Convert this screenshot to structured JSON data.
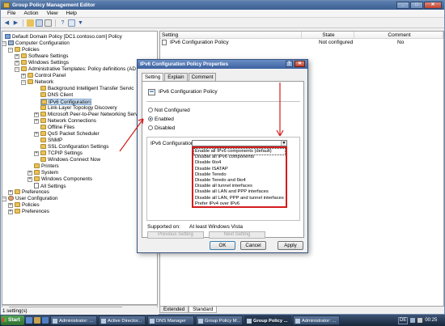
{
  "window": {
    "title": "Group Policy Management Editor",
    "menu": [
      "File",
      "Action",
      "View",
      "Help"
    ]
  },
  "tree": {
    "nodes": [
      {
        "label": "Default Domain Policy [DC1.contoso.com] Policy",
        "icon": "policy-icon"
      },
      {
        "label": "Computer Configuration",
        "icon": "computer-icon"
      },
      {
        "label": "Policies",
        "icon": "folder-icon"
      },
      {
        "label": "Software Settings",
        "icon": "folder-icon"
      },
      {
        "label": "Windows Settings",
        "icon": "folder-icon"
      },
      {
        "label": "Administrative Templates: Policy definitions (AD",
        "icon": "folder-icon"
      },
      {
        "label": "Control Panel",
        "icon": "folder-icon"
      },
      {
        "label": "Network",
        "icon": "folder-icon"
      },
      {
        "label": "Background Intelligent Transfer Servic",
        "icon": "folder-icon"
      },
      {
        "label": "DNS Client",
        "icon": "folder-icon"
      },
      {
        "label": "IPv6 Configuration",
        "icon": "folder-icon"
      },
      {
        "label": "Link-Layer Topology Discovery",
        "icon": "folder-icon"
      },
      {
        "label": "Microsoft Peer-to-Peer Networking Serv",
        "icon": "folder-icon"
      },
      {
        "label": "Network Connections",
        "icon": "folder-icon"
      },
      {
        "label": "Offline Files",
        "icon": "folder-icon"
      },
      {
        "label": "QoS Packet Scheduler",
        "icon": "folder-icon"
      },
      {
        "label": "SNMP",
        "icon": "folder-icon"
      },
      {
        "label": "SSL Configuration Settings",
        "icon": "folder-icon"
      },
      {
        "label": "TCPIP Settings",
        "icon": "folder-icon"
      },
      {
        "label": "Windows Connect Now",
        "icon": "folder-icon"
      },
      {
        "label": "Printers",
        "icon": "folder-icon"
      },
      {
        "label": "System",
        "icon": "folder-icon"
      },
      {
        "label": "Windows Components",
        "icon": "folder-icon"
      },
      {
        "label": "All Settings",
        "icon": "doc-icon"
      },
      {
        "label": "Preferences",
        "icon": "folder-icon"
      },
      {
        "label": "User Configuration",
        "icon": "user-icon"
      },
      {
        "label": "Policies",
        "icon": "folder-icon"
      },
      {
        "label": "Preferences",
        "icon": "folder-icon"
      }
    ]
  },
  "list": {
    "headers": {
      "setting": "Setting",
      "state": "State",
      "comment": "Comment"
    },
    "row": {
      "setting": "IPv6 Configuration Policy",
      "state": "Not configured",
      "comment": "No"
    }
  },
  "bottom_tabs": [
    "Extended",
    "Standard"
  ],
  "status": "1 setting(s)",
  "dialog": {
    "title": "IPv6 Configuration Policy Properties",
    "tabs": [
      "Setting",
      "Explain",
      "Comment"
    ],
    "policy_name": "IPv6 Configuration Policy",
    "radios": [
      "Not Configured",
      "Enabled",
      "Disabled"
    ],
    "selected_radio": "Enabled",
    "option_label": "IPv6 Configuration",
    "dropdown_options": [
      "Enable all IPv6 components (default)",
      "Disable all IPv6 components",
      "Disable 6to4",
      "Disable ISATAP",
      "Disable Teredo",
      "Disable Teredo and 6to4",
      "Disable all tunnel interfaces",
      "Disable all LAN and PPP interfaces",
      "Disable all LAN, PPP and tunnel interfaces",
      "Prefer IPv4 over IPv6"
    ],
    "supported_label": "Supported on:",
    "supported_value": "At least Windows Vista",
    "prev_button": "Previous Setting",
    "next_button": "Next Setting",
    "ok": "OK",
    "cancel": "Cancel",
    "apply": "Apply"
  },
  "taskbar": {
    "start": "Start",
    "tasks": [
      "Administrator: ...",
      "Active Director...",
      "DNS Manager",
      "Group Policy M...",
      "Group Policy ...",
      "Administrator: ..."
    ],
    "active_task_index": 4,
    "language": "DE",
    "clock": "00:25"
  },
  "colors": {
    "annotation": "#d41c1c",
    "titlebar": "#3c5f92"
  }
}
